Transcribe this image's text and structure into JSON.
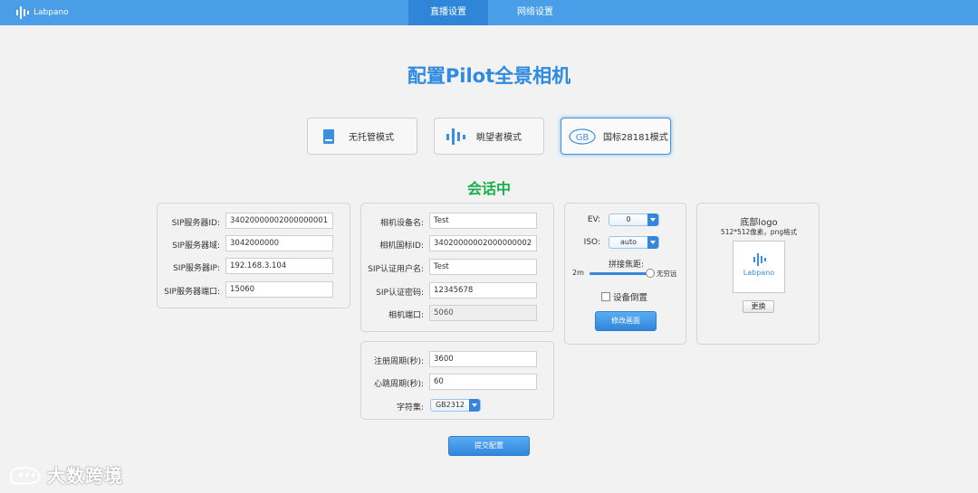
{
  "header": {
    "logo_text": "Labpano",
    "tabs": [
      {
        "label": "直播设置",
        "active": true
      },
      {
        "label": "网络设置",
        "active": false
      }
    ]
  },
  "page_title": "配置Pilot全景相机",
  "modes": [
    {
      "label": "无托管模式",
      "icon": "book-icon"
    },
    {
      "label": "眺望者模式",
      "icon": "signal-bars-icon"
    },
    {
      "label": "国标28181模式",
      "icon": "gb-badge-icon",
      "badge": "GB",
      "active": true
    }
  ],
  "status_text": "会话中",
  "sip_server": {
    "fields": [
      {
        "label": "SIP服务器ID:",
        "value": "34020000002000000001"
      },
      {
        "label": "SIP服务器域:",
        "value": "3042000000"
      },
      {
        "label": "SIP服务器IP:",
        "value": "192.168.3.104"
      },
      {
        "label": "SIP服务器端口:",
        "value": "15060"
      }
    ]
  },
  "camera": {
    "fields": [
      {
        "label": "相机设备名:",
        "value": "Test"
      },
      {
        "label": "相机国标ID:",
        "value": "34020000002000000002"
      },
      {
        "label": "SIP认证用户名:",
        "value": "Test"
      },
      {
        "label": "SIP认证密码:",
        "value": "12345678"
      },
      {
        "label": "相机端口:",
        "value": "5060",
        "disabled": true
      }
    ]
  },
  "register": {
    "fields": [
      {
        "label": "注册周期(秒):",
        "value": "3600"
      },
      {
        "label": "心跳周期(秒):",
        "value": "60"
      }
    ],
    "charset_label": "字符集:",
    "charset_value": "GB2312"
  },
  "image_settings": {
    "ev_label": "EV:",
    "ev_value": "0",
    "iso_label": "ISO:",
    "iso_value": "auto",
    "stitch_label": "拼接焦距:",
    "stitch_min": "2m",
    "stitch_max": "无穷远",
    "stitch_level": 1.0,
    "invert_label": "设备倒置",
    "invert_checked": false,
    "modify_button": "修改画面"
  },
  "bottom_logo": {
    "title": "底部logo",
    "hint": "512*512像素，png格式",
    "preview_text": "Labpano",
    "change_button": "更换"
  },
  "submit_button": "提交配置",
  "watermark_text": "大数跨境",
  "colors": {
    "header": "#4a9ee8",
    "active_tab": "#2f86d8",
    "title": "#2d8ae0",
    "status": "#17b04a",
    "accent": "#3585da"
  }
}
